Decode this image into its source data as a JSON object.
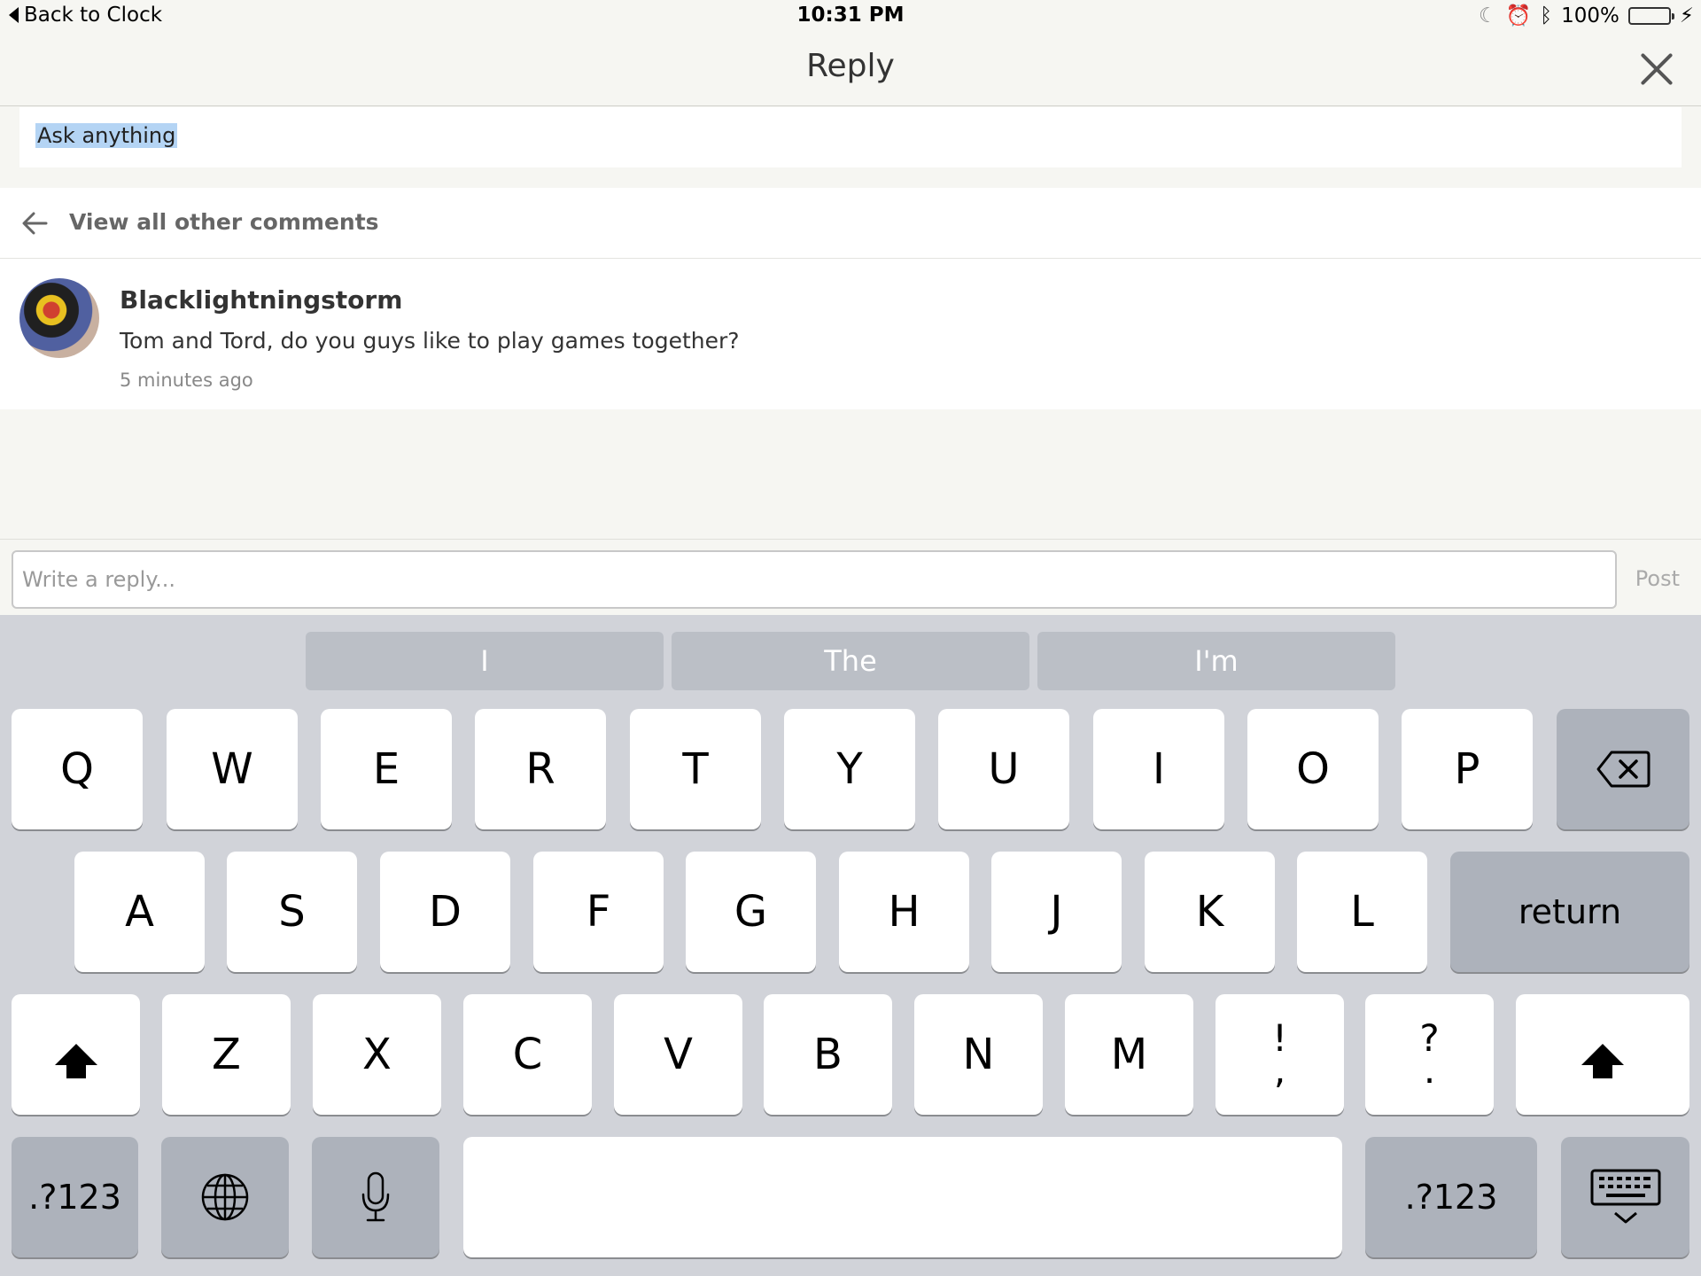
{
  "status_bar": {
    "back_label": "Back to Clock",
    "time": "10:31 PM",
    "battery": "100%"
  },
  "nav": {
    "title": "Reply"
  },
  "question": {
    "text": "Ask anything"
  },
  "comments": {
    "view_all_label": "View all other comments",
    "items": [
      {
        "author": "Blacklightningstorm",
        "text": "Tom and Tord, do you guys like to play games together?",
        "time": "5 minutes ago"
      }
    ]
  },
  "reply": {
    "placeholder": "Write a reply...",
    "post_label": "Post"
  },
  "keyboard": {
    "suggestions": [
      "I",
      "The",
      "I'm"
    ],
    "row1": [
      "Q",
      "W",
      "E",
      "R",
      "T",
      "Y",
      "U",
      "I",
      "O",
      "P"
    ],
    "row2": [
      "A",
      "S",
      "D",
      "F",
      "G",
      "H",
      "J",
      "K",
      "L"
    ],
    "return_label": "return",
    "row3": [
      "Z",
      "X",
      "C",
      "V",
      "B",
      "N",
      "M"
    ],
    "punct1_top": "!",
    "punct1_bottom": ",",
    "punct2_top": "?",
    "punct2_bottom": ".",
    "numbers_label": ".?123",
    "accent_color": "#4cd964"
  }
}
